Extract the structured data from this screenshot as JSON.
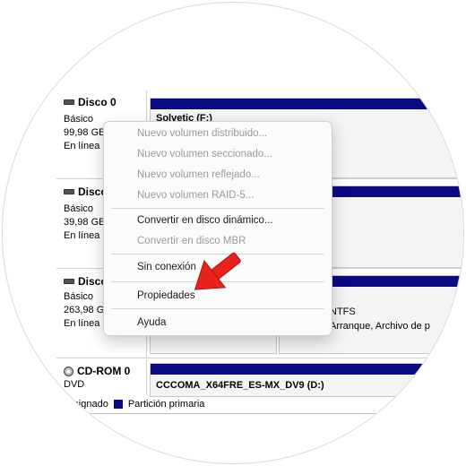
{
  "disks": [
    {
      "name": "Disco 0",
      "type": "Básico",
      "size": "99,98 GB",
      "status": "En línea"
    },
    {
      "name": "Disco",
      "type": "Básico",
      "size": "39,98 GB",
      "status": "En línea"
    },
    {
      "name": "Disco",
      "type": "Básico",
      "size": "263,98 G",
      "status": "En línea"
    },
    {
      "name": "CD-ROM 0",
      "type": "DVD",
      "status": "o asignado"
    }
  ],
  "volumes": {
    "disk0_label": "Solvetic (F:)",
    "disk2_fs": "NTFS",
    "disk2_status": "Arranque, Archivo de p",
    "cd_label": "CCCOMA_X64FRE_ES-MX_DV9  (D:)"
  },
  "legend": {
    "primary": "Partición primaria"
  },
  "menu": {
    "items": [
      "Nuevo volumen distribuido...",
      "Nuevo volumen seccionado...",
      "Nuevo volumen reflejado...",
      "Nuevo volumen RAID-5...",
      "Convertir en disco dinámico...",
      "Convertir en disco MBR",
      "Sin conexión",
      "Propiedades",
      "Ayuda"
    ]
  },
  "colors": {
    "partition_bar": "#0a0a85",
    "arrow": "#e8221c"
  }
}
